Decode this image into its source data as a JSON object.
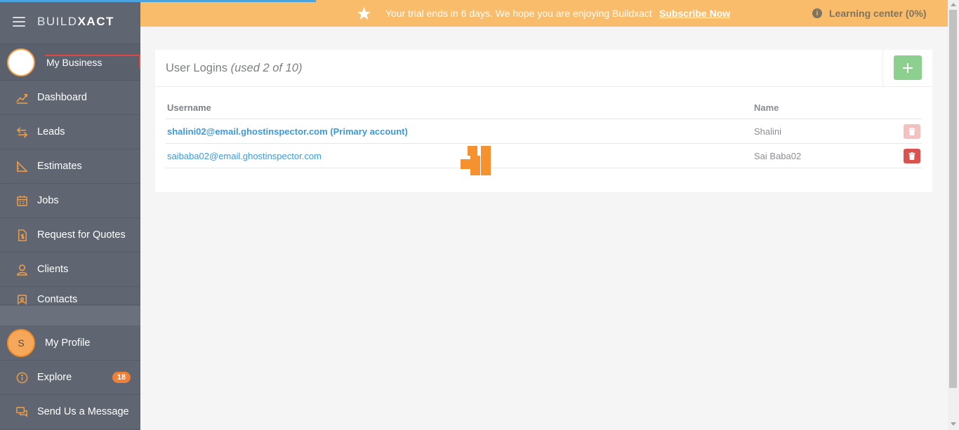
{
  "sidebar": {
    "brand_light": "BUILD",
    "brand_bold": "XACT",
    "business_label": "My Business",
    "nav": [
      {
        "label": "Dashboard",
        "icon": "chart-line-icon"
      },
      {
        "label": "Leads",
        "icon": "arrows-exchange-icon"
      },
      {
        "label": "Estimates",
        "icon": "ruler-triangle-icon"
      },
      {
        "label": "Jobs",
        "icon": "calendar-icon"
      },
      {
        "label": "Request for Quotes",
        "icon": "document-dollar-icon"
      },
      {
        "label": "Clients",
        "icon": "user-icon"
      },
      {
        "label": "Contacts",
        "icon": "address-book-icon"
      }
    ],
    "profile": {
      "initial": "S",
      "label": "My Profile"
    },
    "explore": {
      "label": "Explore",
      "badge": "18"
    },
    "message": {
      "label": "Send Us a Message"
    }
  },
  "banner": {
    "message": "Your trial ends in 6 days. We hope you are enjoying Buildxact",
    "subscribe": "Subscribe Now",
    "learning_center": "Learning center (0%)"
  },
  "card": {
    "title": "User Logins",
    "usage": "(used 2 of 10)",
    "columns": {
      "username": "Username",
      "name": "Name"
    },
    "rows": [
      {
        "username": "shalini02@email.ghostinspector.com (Primary account)",
        "name": "Shalini",
        "primary": true
      },
      {
        "username": "saibaba02@email.ghostinspector.com",
        "name": "Sai Baba02",
        "primary": false
      }
    ]
  },
  "colors": {
    "sidebar": "#5f6671",
    "banner": "#f9bc6b",
    "accent_orange": "#f5922f",
    "link_blue": "#3d9ad8",
    "add_green": "#8ccf8f",
    "delete_red": "#d9534f"
  }
}
